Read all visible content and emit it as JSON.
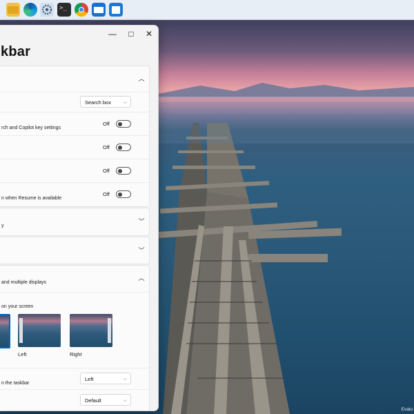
{
  "taskbar": {
    "icons": [
      "file-explorer-icon",
      "edge-browser-icon",
      "settings-gear-icon",
      "terminal-icon",
      "chrome-browser-icon",
      "mail-icon",
      "store-icon"
    ]
  },
  "window": {
    "title": "kbar",
    "controls": {
      "minimize": "—",
      "maximize": "□",
      "close": "✕"
    },
    "sections": {
      "search_row": {
        "select_value": "Search box"
      },
      "copilot_row": {
        "desc": "rch and Copilot key settings",
        "state": "Off"
      },
      "row2": {
        "state": "Off"
      },
      "row3": {
        "state": "Off"
      },
      "resume_row": {
        "desc": "n when Resume is available",
        "state": "Off"
      },
      "card2": {
        "text": "y"
      },
      "behaviors": {
        "desc": "and multiple displays",
        "sub": "on your screen",
        "thumb_left": "Left",
        "thumb_right": "Right",
        "alignment_desc": "n the taskbar",
        "alignment_value": "Left",
        "last_value": "Default"
      }
    }
  },
  "desktop": {
    "watermark": "Evalu"
  },
  "colors": {
    "accent": "#0067c0",
    "window_bg": "#f3f3f3",
    "card_bg": "#fbfbfb"
  }
}
